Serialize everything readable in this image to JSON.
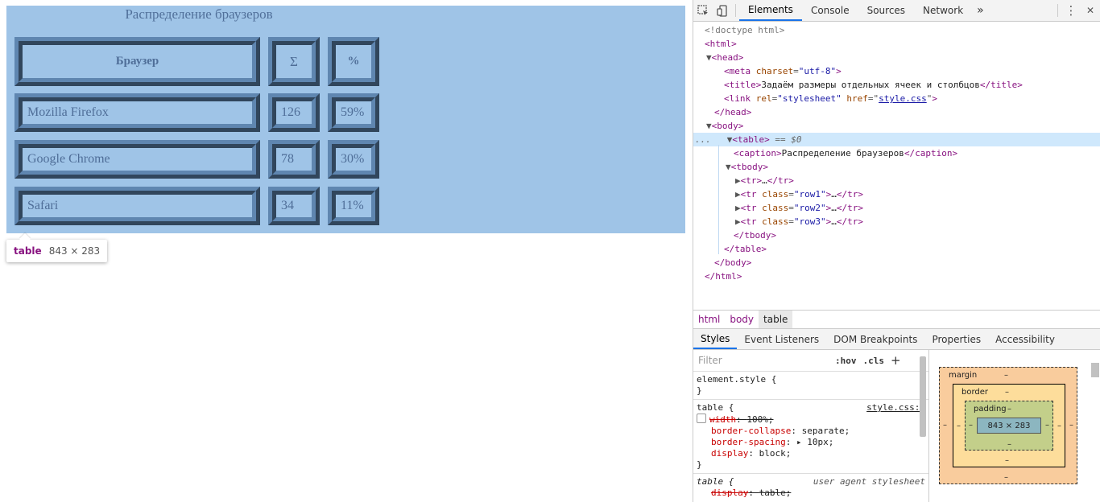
{
  "page": {
    "caption": "Распределение браузеров",
    "table": {
      "headers": [
        "Браузер",
        "Σ",
        "%"
      ],
      "rows": [
        [
          "Mozilla Firefox",
          "126",
          "59%"
        ],
        [
          "Google Chrome",
          "78",
          "30%"
        ],
        [
          "Safari",
          "34",
          "11%"
        ]
      ]
    },
    "tooltip": {
      "tag": "table",
      "dims": "843 × 283"
    }
  },
  "devtools": {
    "tabs": [
      "Elements",
      "Console",
      "Sources",
      "Network"
    ],
    "active_tab": "Elements",
    "more_tabs": "»",
    "kebab": "⋮",
    "close": "✕",
    "dom": {
      "doctype": "<!doctype html>",
      "html": "html",
      "head": "head",
      "meta_tag": "meta",
      "meta_attr": "charset",
      "meta_val": "\"utf-8\"",
      "title_tag": "title",
      "title_text": "Задаём размеры отдельных ячеек и столбцов",
      "link_tag": "link",
      "link_rel_attr": "rel",
      "link_rel_val": "\"stylesheet\"",
      "link_href_attr": "href",
      "link_href_val": "style.css",
      "body": "body",
      "table": "table",
      "table_marker": "== $0",
      "caption_tag": "caption",
      "caption_text": "Распределение браузеров",
      "tbody": "tbody",
      "tr": "tr",
      "ellipsis": "…",
      "class_attr": "class",
      "row_classes": [
        "\"row1\"",
        "\"row2\"",
        "\"row3\""
      ],
      "dots": "..."
    },
    "breadcrumb": [
      "html",
      "body",
      "table"
    ],
    "sub_tabs": [
      "Styles",
      "Event Listeners",
      "DOM Breakpoints",
      "Properties",
      "Accessibility"
    ],
    "styles": {
      "filter_placeholder": "Filter",
      "hov": ":hov",
      "cls": ".cls",
      "plus": "+",
      "element_style": "element.style {",
      "close_brace": "}",
      "rule1_selector": "table {",
      "rule1_source": "style.css:1",
      "rule1_props": [
        {
          "name": "width",
          "value": "100%;",
          "struck": true
        },
        {
          "name": "border-collapse",
          "value": "separate;",
          "struck": false
        },
        {
          "name": "border-spacing",
          "value": "10px;",
          "struck": false,
          "expand": "▸ "
        },
        {
          "name": "display",
          "value": "block;",
          "struck": false
        }
      ],
      "rule2_selector": "table {",
      "rule2_source": "user agent stylesheet",
      "rule2_props": [
        {
          "name": "display",
          "value": "table;",
          "struck": true
        }
      ]
    },
    "box_model": {
      "margin": "margin",
      "border": "border",
      "padding": "padding",
      "content": "843 × 283",
      "dash": "–"
    }
  }
}
